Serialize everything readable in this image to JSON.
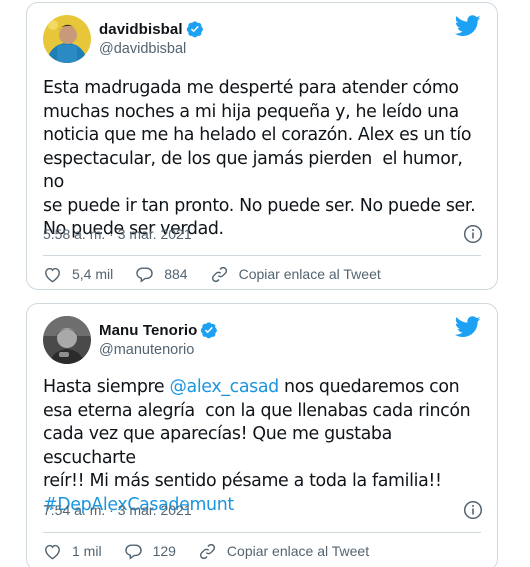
{
  "colors": {
    "twitter_blue": "#1da1f2",
    "link_blue": "#1b95e0",
    "secondary_text": "#536471",
    "border": "#cfd9de",
    "like_red_outline": "#536471"
  },
  "tweets": [
    {
      "display_name": "davidbisbal",
      "handle": "@davidbisbal",
      "verified": true,
      "avatar_icon": "avatar-davidbisbal",
      "text": "Esta madrugada me desperté para atender cómo\nmuchas noches a mi hija pequeña y, he leído una\nnoticia que me ha helado el corazón. Alex es un tío\nespectacular, de los que jamás pierden  el humor, no\nse puede ir tan pronto. No puede ser. No puede ser.\nNo puede ser verdad.",
      "timestamp": "5:58 a. m. · 3 mar. 2021",
      "likes": "5,4 mil",
      "replies": "884",
      "copy_link_label": "Copiar enlace al Tweet"
    },
    {
      "display_name": "Manu Tenorio",
      "handle": "@manutenorio",
      "verified": true,
      "avatar_icon": "avatar-manutenorio",
      "text_line1_prefix": "Hasta siempre ",
      "text_mention": "@alex_casad",
      "text_line1_suffix": " nos quedaremos con",
      "text_rest": "esa eterna alegría  con la que llenabas cada rincón\ncada vez que aparecías! Que me gustaba escucharte\nreír!! Mi más sentido pésame a toda la familia!!",
      "text_hashtag": "#DepAlexCasademunt",
      "timestamp": "7:54 a. m. · 3 mar. 2021",
      "likes": "1 mil",
      "replies": "129",
      "copy_link_label": "Copiar enlace al Tweet"
    }
  ]
}
